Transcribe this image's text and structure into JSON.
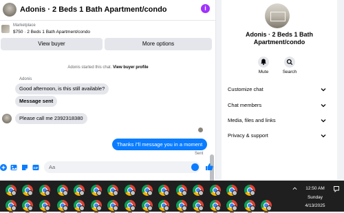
{
  "chat": {
    "title": "Adonis · 2 Beds 1 Bath Apartment/condo",
    "listing_category": "Marketplace",
    "listing_name": "$750 · 2 Beds 1 Bath Apartment/condo",
    "view_buyer_label": "View buyer",
    "more_options_label": "More options",
    "system_message_prefix": "Adonis started this chat.",
    "system_message_link": "View buyer profile",
    "sender_name": "Adonis",
    "messages_in": [
      "Good afternoon, is this still available?",
      "Message sent",
      "Please call me 2392318380"
    ],
    "message_out": "Thanks i\"ll message you in a moment",
    "sent_status": "Sent",
    "composer_placeholder": "Aa",
    "accent_color": "#0a7cff"
  },
  "info_panel": {
    "title": "Adonis · 2 Beds 1 Bath Apartment/condo",
    "mute_label": "Mute",
    "search_label": "Search",
    "menu": [
      {
        "label": "Customize chat",
        "icon": "chevron-down-icon"
      },
      {
        "label": "Chat members",
        "icon": "chevron-down-icon"
      },
      {
        "label": "Media, files and links",
        "icon": "chevron-down-icon"
      },
      {
        "label": "Privacy & support",
        "icon": "chevron-down-icon"
      }
    ]
  },
  "taskbar": {
    "app_icon": "chrome-icon",
    "time": "12:50 AM",
    "day": "Sunday",
    "date": "4/13/2025"
  }
}
